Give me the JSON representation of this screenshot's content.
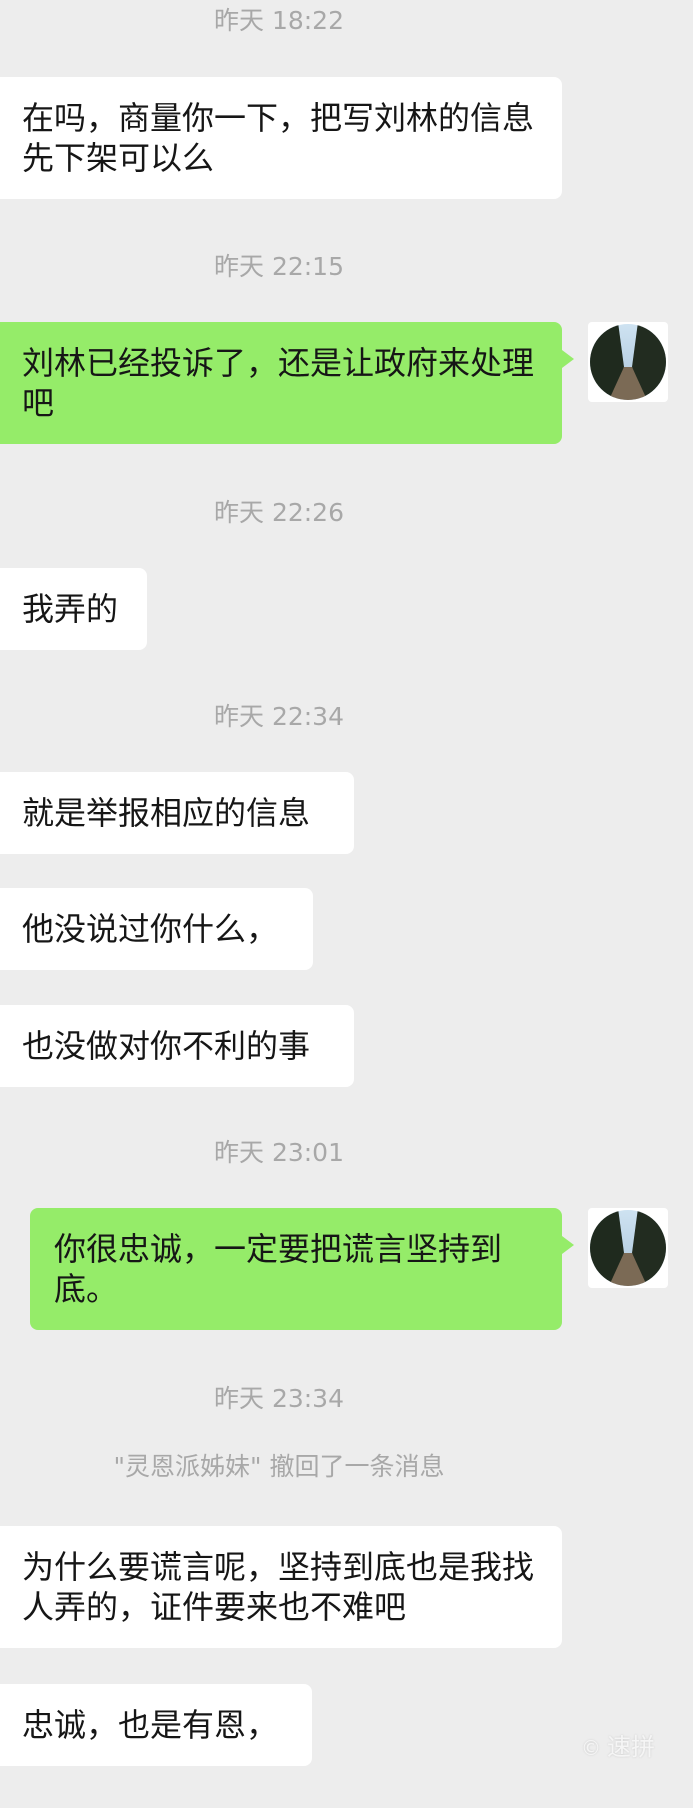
{
  "timestamps": {
    "t1": "昨天 18:22",
    "t2": "昨天 22:15",
    "t3": "昨天 22:26",
    "t4": "昨天 22:34",
    "t5": "昨天 23:01",
    "t6": "昨天 23:34"
  },
  "messages": {
    "m1": "在吗，商量你一下，把写刘林的信息先下架可以么",
    "m2": "刘林已经投诉了，还是让政府来处理吧",
    "m3": "我弄的",
    "m4": "就是举报相应的信息",
    "m5": "他没说过你什么，",
    "m6": "也没做对你不利的事",
    "m7": "你很忠诚，一定要把谎言坚持到底。",
    "m8": "为什么要谎言呢，坚持到底也是我找人弄的，证件要来也不难吧",
    "m9": "忠诚，也是有恩，"
  },
  "system": {
    "recall": "\"灵恩派姊妹\" 撤回了一条消息"
  },
  "watermark": {
    "symbol": "©",
    "text": "速拼"
  },
  "colors": {
    "background": "#ededed",
    "incoming_bubble": "#ffffff",
    "outgoing_bubble": "#95ec69",
    "timestamp_text": "#a8a8a8"
  },
  "icons": {
    "avatar": "avatar-forest-road-photo"
  }
}
